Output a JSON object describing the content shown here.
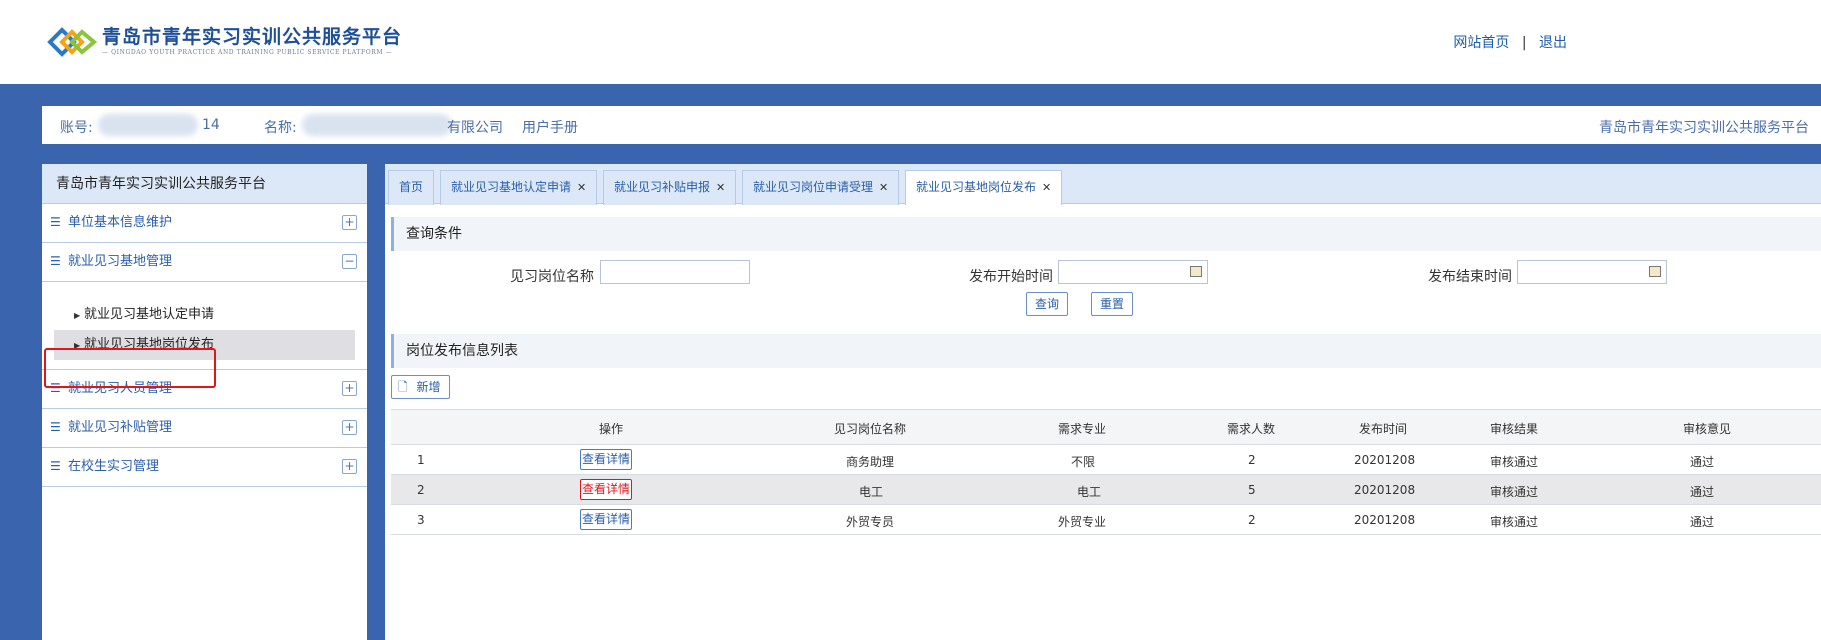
{
  "header": {
    "title": "青岛市青年实习实训公共服务平台",
    "subtitle": "— QINGDAO YOUTH PRACTICE AND TRAINING PUBLIC SERVICE PLATFORM —",
    "links": [
      "网站首页",
      "退出"
    ],
    "separator": "|"
  },
  "info_bar": {
    "account_label": "账号:",
    "account_suffix": "14",
    "name_label": "名称:",
    "name_suffix": "有限公司",
    "manual": "用户手册",
    "right_title": "青岛市青年实习实训公共服务平台"
  },
  "sidebar": {
    "title": "青岛市青年实习实训公共服务平台",
    "menus": [
      {
        "label": "单位基本信息维护",
        "toggle": "+"
      },
      {
        "label": "就业见习基地管理",
        "toggle": "−"
      },
      {
        "label": "就业见习人员管理",
        "toggle": "+"
      },
      {
        "label": "就业见习补贴管理",
        "toggle": "+"
      },
      {
        "label": "在校生实习管理",
        "toggle": "+"
      }
    ],
    "subitems": [
      "就业见习基地认定申请",
      "就业见习基地岗位发布"
    ]
  },
  "tabs": [
    {
      "label": "首页"
    },
    {
      "label": "就业见习基地认定申请"
    },
    {
      "label": "就业见习补贴申报"
    },
    {
      "label": "就业见习岗位申请受理"
    },
    {
      "label": "就业见习基地岗位发布"
    }
  ],
  "query": {
    "heading": "查询条件",
    "position_name_label": "见习岗位名称",
    "start_time_label": "发布开始时间",
    "end_time_label": "发布结束时间",
    "search_btn": "查询",
    "reset_btn": "重置"
  },
  "list": {
    "heading": "岗位发布信息列表",
    "add_btn": "新增",
    "columns": [
      "操作",
      "见习岗位名称",
      "需求专业",
      "需求人数",
      "发布时间",
      "审核结果",
      "审核意见"
    ],
    "detail_label": "查看详情",
    "rows": [
      {
        "no": "1",
        "name": "商务助理",
        "major": "不限",
        "count": "2",
        "date": "20201208",
        "result": "审核通过",
        "opinion": "通过"
      },
      {
        "no": "2",
        "name": "电工",
        "major": "电工",
        "count": "5",
        "date": "20201208",
        "result": "审核通过",
        "opinion": "通过"
      },
      {
        "no": "3",
        "name": "外贸专员",
        "major": "外贸专业",
        "count": "2",
        "date": "20201208",
        "result": "审核通过",
        "opinion": "通过"
      }
    ]
  },
  "colors": {
    "frame_blue": "#3a64ad",
    "accent_blue": "#2a5ea8",
    "highlight_red": "#e0161a"
  }
}
